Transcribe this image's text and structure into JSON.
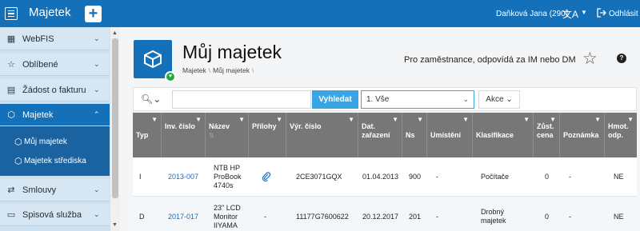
{
  "header": {
    "app_title": "Majetek",
    "user": "Daňková Jana (290)",
    "logout": "Odhlásit"
  },
  "sidebar": {
    "items": [
      {
        "label": "WebFIS",
        "icon": "grid-icon"
      },
      {
        "label": "Oblíbené",
        "icon": "star-icon"
      },
      {
        "label": "Žádost o fakturu",
        "icon": "document-icon"
      },
      {
        "label": "Majetek",
        "icon": "box-icon"
      },
      {
        "label": "Smlouvy",
        "icon": "handshake-icon"
      },
      {
        "label": "Spisová služba",
        "icon": "folder-icon"
      }
    ],
    "subitems": [
      {
        "label": "Můj majetek",
        "icon": "box-heart-icon"
      },
      {
        "label": "Majetek střediska",
        "icon": "boxes-icon"
      }
    ]
  },
  "page": {
    "title": "Můj majetek",
    "breadcrumb": [
      "Majetek",
      "Můj majetek"
    ],
    "description": "Pro zaměstnance, odpovídá za IM nebo DM"
  },
  "search": {
    "button": "Vyhledat",
    "select_value": "1. Vše",
    "akce": "Akce"
  },
  "table": {
    "columns": [
      "Typ",
      "Inv. číslo",
      "Název",
      "Přílohy",
      "Výr. číslo",
      "Dat. zařazení",
      "Ns",
      "Umístění",
      "Klasifikace",
      "Zůst. cena",
      "Poznámka",
      "Hmot. odp."
    ],
    "rows": [
      {
        "typ": "I",
        "inv": "2013-007",
        "nazev": "NTB HP ProBook 4740s",
        "prilohy": "paperclip-icon",
        "vyr": "2CE3071GQX",
        "dat": "01.04.2013",
        "ns": "900",
        "umisteni": "-",
        "klas": "Počítače",
        "cena": "0",
        "pozn": "-",
        "hmot": "NE"
      },
      {
        "typ": "D",
        "inv": "2017-017",
        "nazev": "23\" LCD Monitor IIYAMA",
        "prilohy": "-",
        "vyr": "11177G7600622",
        "dat": "20.12.2017",
        "ns": "201",
        "umisteni": "-",
        "klas": "Drobný majetek",
        "cena": "0",
        "pozn": "-",
        "hmot": "NE"
      }
    ]
  },
  "colors": {
    "brand": "#1470b8",
    "accent": "#3aa5e4",
    "header_grey": "#777777",
    "badge_green": "#22a842"
  }
}
